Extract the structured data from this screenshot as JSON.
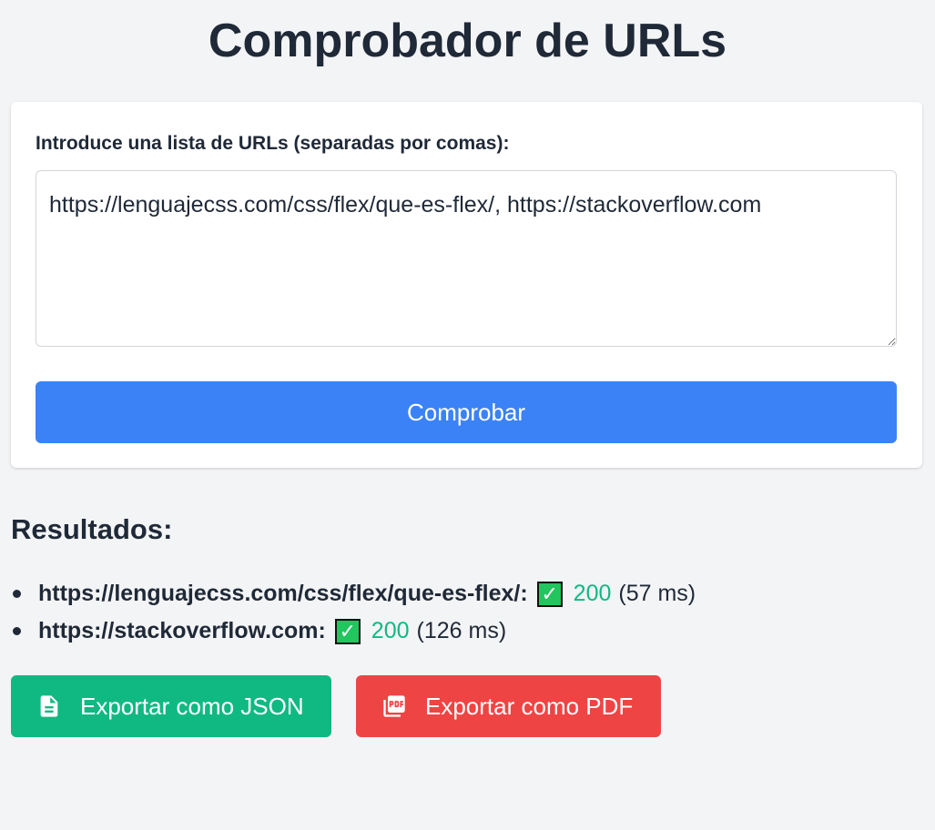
{
  "page": {
    "title": "Comprobador de URLs"
  },
  "form": {
    "label": "Introduce una lista de URLs (separadas por comas):",
    "textarea_value": "https://lenguajecss.com/css/flex/que-es-flex/, https://stackoverflow.com",
    "submit_label": "Comprobar"
  },
  "results": {
    "title": "Resultados:",
    "items": [
      {
        "url": "https://lenguajecss.com/css/flex/que-es-flex/:",
        "status_icon": "check-mark-icon",
        "status": "200",
        "time": "(57 ms)"
      },
      {
        "url": "https://stackoverflow.com:",
        "status_icon": "check-mark-icon",
        "status": "200",
        "time": "(126 ms)"
      }
    ]
  },
  "export": {
    "json_label": "Exportar como JSON",
    "json_icon": "file-icon",
    "pdf_label": "Exportar como PDF",
    "pdf_icon": "pdf-icon"
  },
  "colors": {
    "background": "#f3f4f6",
    "primary_button": "#3b82f6",
    "json_button": "#10b981",
    "pdf_button": "#ef4444",
    "status_ok": "#10b981"
  }
}
